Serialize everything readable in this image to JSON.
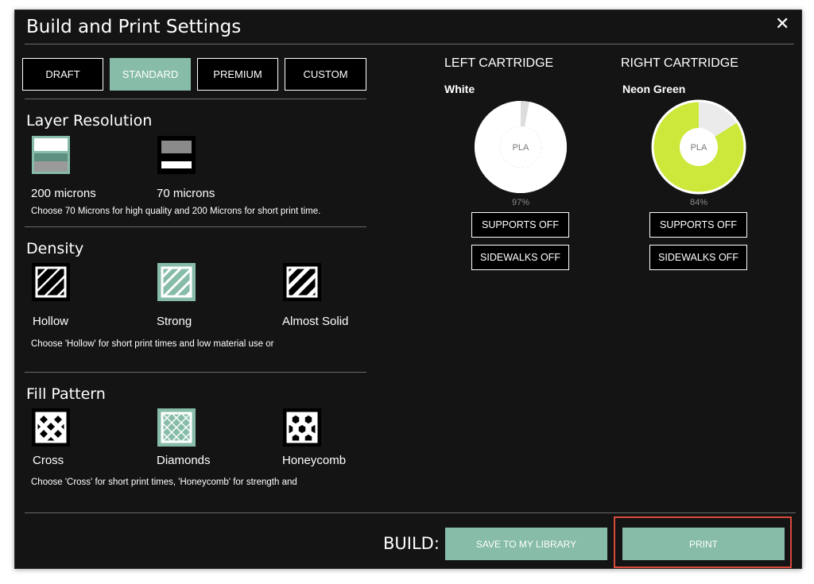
{
  "dialog": {
    "title": "Build and Print Settings",
    "close_label": "✕"
  },
  "quality_tabs": [
    {
      "label": "DRAFT",
      "selected": false
    },
    {
      "label": "STANDARD",
      "selected": true
    },
    {
      "label": "PREMIUM",
      "selected": false
    },
    {
      "label": "CUSTOM",
      "selected": false
    }
  ],
  "layer_resolution": {
    "title": "Layer Resolution",
    "options": [
      {
        "label": "200 microns",
        "selected": true
      },
      {
        "label": "70 microns",
        "selected": false
      }
    ],
    "hint": "Choose 70 Microns for high quality and 200 Microns for short print time."
  },
  "density": {
    "title": "Density",
    "options": [
      {
        "label": "Hollow",
        "selected": false
      },
      {
        "label": "Strong",
        "selected": true
      },
      {
        "label": "Almost Solid",
        "selected": false
      }
    ],
    "hint": "Choose 'Hollow' for short print times and low material use or"
  },
  "fill_pattern": {
    "title": "Fill Pattern",
    "options": [
      {
        "label": "Cross",
        "selected": false
      },
      {
        "label": "Diamonds",
        "selected": true
      },
      {
        "label": "Honeycomb",
        "selected": false
      }
    ],
    "hint": "Choose 'Cross' for short print times, 'Honeycomb' for strength and"
  },
  "cartridges": {
    "left": {
      "title": "LEFT CARTRIDGE",
      "color_name": "White",
      "material": "PLA",
      "percent_label": "97%",
      "fill_fraction": 0.97,
      "fill_color": "#ffffff",
      "supports_label": "SUPPORTS OFF",
      "sidewalks_label": "SIDEWALKS OFF"
    },
    "right": {
      "title": "RIGHT CARTRIDGE",
      "color_name": "Neon Green",
      "material": "PLA",
      "percent_label": "84%",
      "fill_fraction": 0.84,
      "fill_color": "#cde83a",
      "supports_label": "SUPPORTS OFF",
      "sidewalks_label": "SIDEWALKS OFF"
    }
  },
  "footer": {
    "build_label": "BUILD:",
    "save_label": "SAVE TO MY LIBRARY",
    "print_label": "PRINT"
  },
  "colors": {
    "accent": "#86bca8",
    "background": "#141414",
    "highlight": "#d94a3c"
  }
}
